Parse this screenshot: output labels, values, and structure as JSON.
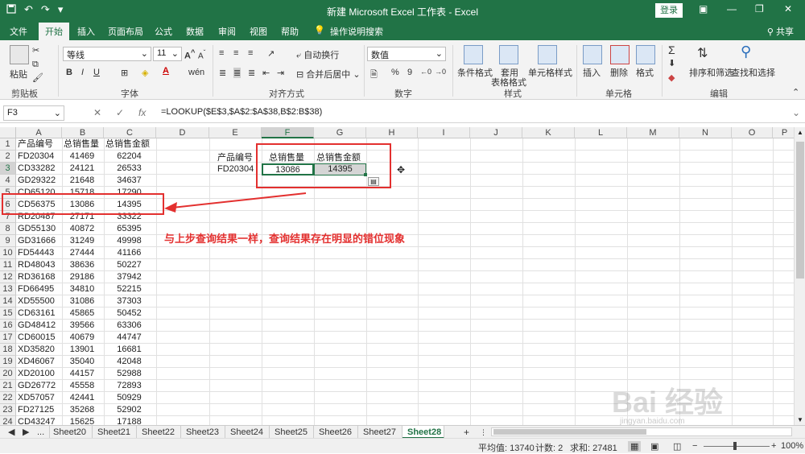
{
  "titlebar": {
    "title": "新建 Microsoft Excel 工作表 - Excel",
    "login": "登录",
    "qat_save_icon": "save-icon",
    "qat_undo_icon": "undo-icon",
    "qat_redo_icon": "redo-icon",
    "qat_customize_icon": "customize-icon"
  },
  "tabs": [
    "文件",
    "开始",
    "插入",
    "页面布局",
    "公式",
    "数据",
    "审阅",
    "视图",
    "帮助",
    "操作说明搜索"
  ],
  "share_label": "共享",
  "ribbon": {
    "clipboard": {
      "paste": "粘贴",
      "group": "剪贴板"
    },
    "font": {
      "name": "等线",
      "size": "11",
      "bold": "B",
      "italic": "I",
      "underline": "U",
      "group": "字体",
      "grow": "A",
      "shrink": "A",
      "phonetic": "wén"
    },
    "alignment": {
      "wrap": "自动换行",
      "merge": "合并后居中",
      "group": "对齐方式"
    },
    "number": {
      "format": "数值",
      "percent": "%",
      "comma": "9",
      "group": "数字"
    },
    "styles": {
      "conditional": "条件格式",
      "table": "套用",
      "table2": "表格格式",
      "cell": "单元格样式",
      "group": "样式"
    },
    "cells": {
      "insert": "插入",
      "delete": "删除",
      "format": "格式",
      "group": "单元格"
    },
    "editing": {
      "sum": "Σ",
      "sort": "排序和筛选",
      "find": "查找和选择",
      "group": "编辑"
    }
  },
  "formula_bar": {
    "name_box": "F3",
    "cancel": "✕",
    "confirm": "✓",
    "fx": "fx",
    "formula": "=LOOKUP($E$3,$A$2:$A$38,B$2:B$38)"
  },
  "columns": [
    "A",
    "B",
    "C",
    "D",
    "E",
    "F",
    "G",
    "H",
    "I",
    "J",
    "K",
    "L",
    "M",
    "N",
    "O",
    "P"
  ],
  "rows": [
    [
      "产品编号",
      "总销售量",
      "总销售金额"
    ],
    [
      "FD20304",
      "41469",
      "62204"
    ],
    [
      "CD33282",
      "24121",
      "26533"
    ],
    [
      "GD29322",
      "21648",
      "34637"
    ],
    [
      "CD65120",
      "15718",
      "17290"
    ],
    [
      "CD56375",
      "13086",
      "14395"
    ],
    [
      "RD20487",
      "27171",
      "33322"
    ],
    [
      "GD55130",
      "40872",
      "65395"
    ],
    [
      "GD31666",
      "31249",
      "49998"
    ],
    [
      "FD54443",
      "27444",
      "41166"
    ],
    [
      "RD48043",
      "38636",
      "50227"
    ],
    [
      "RD36168",
      "29186",
      "37942"
    ],
    [
      "FD66495",
      "34810",
      "52215"
    ],
    [
      "XD55500",
      "31086",
      "37303"
    ],
    [
      "CD63161",
      "45865",
      "50452"
    ],
    [
      "GD48412",
      "39566",
      "63306"
    ],
    [
      "CD60015",
      "40679",
      "44747"
    ],
    [
      "XD35820",
      "13901",
      "16681"
    ],
    [
      "XD46067",
      "35040",
      "42048"
    ],
    [
      "XD20100",
      "44157",
      "52988"
    ],
    [
      "GD26772",
      "45558",
      "72893"
    ],
    [
      "XD57057",
      "42441",
      "50929"
    ],
    [
      "FD27125",
      "35268",
      "52902"
    ],
    [
      "CD43247",
      "15625",
      "17188"
    ]
  ],
  "lookup": {
    "e2": "产品编号",
    "f2": "总销售量",
    "g2": "总销售金额",
    "e3": "FD20304",
    "f3": "13086",
    "g3": "14395"
  },
  "annotation": "与上步查询结果一样，查询结果存在明显的错位现象",
  "sheets": [
    "Sheet20",
    "Sheet21",
    "Sheet22",
    "Sheet23",
    "Sheet24",
    "Sheet25",
    "Sheet26",
    "Sheet27",
    "Sheet28"
  ],
  "sheet_nav": {
    "ellipsis": "...",
    "add": "+"
  },
  "status": {
    "average": "平均值: 13740",
    "count": "计数: 2",
    "sum": "求和: 27481",
    "zoom": "100%"
  },
  "watermark": {
    "brand": "Bai 经验",
    "url": "jingyan.baidu.com"
  },
  "accent_color": "#217346",
  "annotation_color": "#e3302f"
}
